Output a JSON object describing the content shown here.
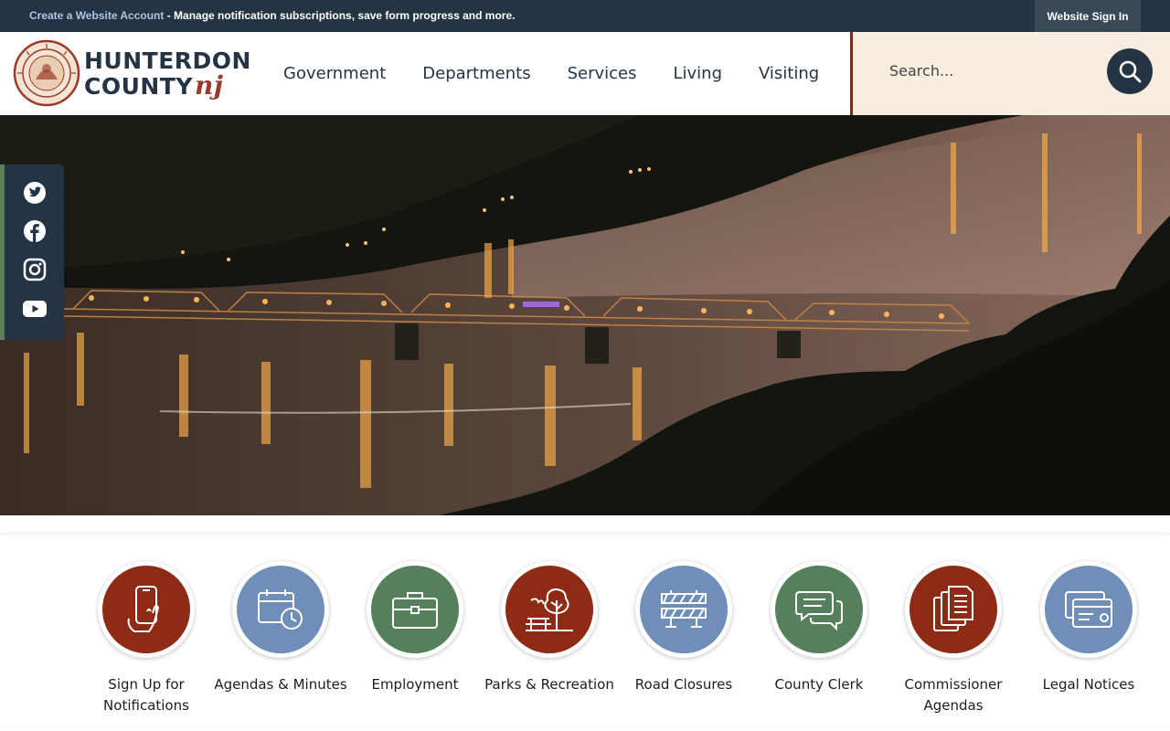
{
  "topbar": {
    "create_link": "Create a Website Account",
    "message": " - Manage notification subscriptions, save form progress and more.",
    "signin": "Website Sign In"
  },
  "logo": {
    "line1": "HUNTERDON",
    "line2": "COUNTY",
    "nj": "nj",
    "seal_top": "HUNTERDON COUNTY",
    "seal_bottom": "NEW JERSEY"
  },
  "nav": {
    "items": [
      "Government",
      "Departments",
      "Services",
      "Living",
      "Visiting"
    ]
  },
  "search": {
    "placeholder": "Search..."
  },
  "social": {
    "icons": [
      "twitter-icon",
      "facebook-icon",
      "instagram-icon",
      "youtube-icon"
    ]
  },
  "quick_links": [
    {
      "label": "Sign Up for Notifications",
      "icon": "smartphone-icon",
      "color": "#8e2b14"
    },
    {
      "label": "Agendas & Minutes",
      "icon": "calendar-clock-icon",
      "color": "#6f8fb8"
    },
    {
      "label": "Employment",
      "icon": "briefcase-icon",
      "color": "#56805b"
    },
    {
      "label": "Parks & Recreation",
      "icon": "park-icon",
      "color": "#8e2b14"
    },
    {
      "label": "Road Closures",
      "icon": "road-barrier-icon",
      "color": "#6f8fb8"
    },
    {
      "label": "County Clerk",
      "icon": "chat-bubbles-icon",
      "color": "#56805b"
    },
    {
      "label": "Commissioner Agendas",
      "icon": "documents-icon",
      "color": "#8e2b14"
    },
    {
      "label": "Legal Notices",
      "icon": "card-icon",
      "color": "#6f8fb8"
    }
  ],
  "colors": {
    "navy": "#253444",
    "rust": "#8e2b14",
    "slate_blue": "#6f8fb8",
    "sage": "#56805b",
    "cream": "#f8eedf"
  }
}
